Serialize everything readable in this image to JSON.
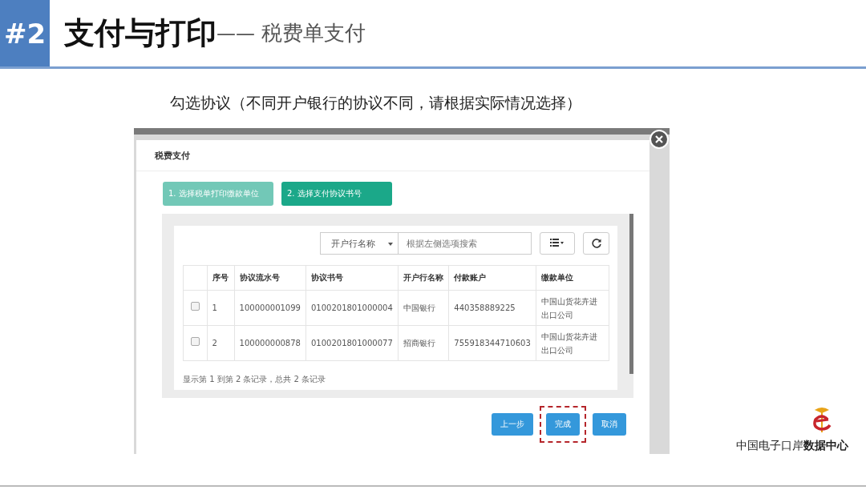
{
  "header": {
    "number": "#2",
    "title": "支付与打印",
    "dash": "——",
    "subtitle": "税费单支付"
  },
  "caption": "勾选协议（不同开户银行的协议不同，请根据实际情况选择）",
  "dialog": {
    "title": "税费支付",
    "steps": [
      {
        "label": "1. 选择税单打印缴款单位",
        "selected": false
      },
      {
        "label": "2. 选择支付协议书号",
        "selected": true
      }
    ],
    "filter": {
      "select": "开户行名称",
      "placeholder": "根据左侧选项搜索"
    },
    "table": {
      "columns": [
        "序号",
        "协议流水号",
        "协议书号",
        "开户行名称",
        "付款账户",
        "缴款单位"
      ],
      "rows": [
        {
          "checked": false,
          "cells": [
            "1",
            "100000001099",
            "0100201801000004",
            "中国银行",
            "440358889225",
            "中国山货花卉进出口公司"
          ]
        },
        {
          "checked": false,
          "cells": [
            "2",
            "100000000878",
            "0100201801000077",
            "招商银行",
            "755918344710603",
            "中国山货花卉进出口公司"
          ]
        }
      ]
    },
    "summary": "显示第 1 到第 2 条记录，总共 2 条记录",
    "buttons": [
      {
        "label": "上一步",
        "highlighted": false
      },
      {
        "label": "完成",
        "highlighted": true
      },
      {
        "label": "取消",
        "highlighted": false
      }
    ]
  },
  "footer": {
    "brand_light": "中国电子口岸",
    "brand_bold": "数据中心"
  }
}
